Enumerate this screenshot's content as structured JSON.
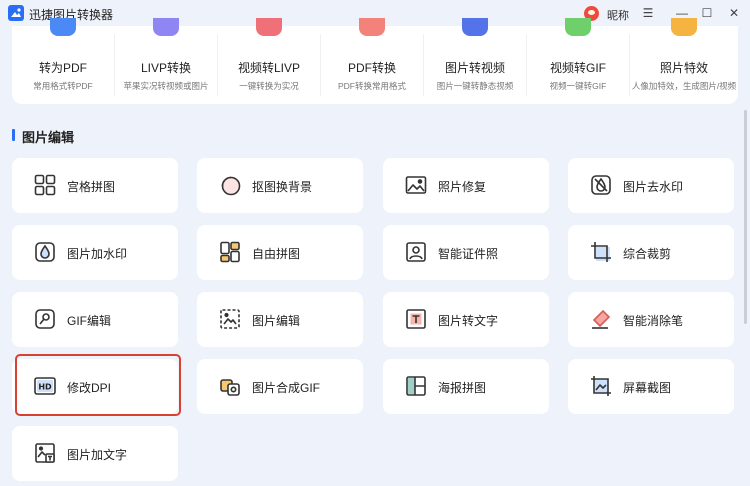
{
  "app": {
    "title": "迅捷图片转换器",
    "nickname": "昵称",
    "accent_color": "#2b6ef6",
    "window_controls": [
      "☺",
      "☰",
      "—",
      "☐",
      "✕"
    ]
  },
  "top_features": [
    {
      "name": "转为PDF",
      "desc": "常用格式转PDF",
      "color": "#4b8af5"
    },
    {
      "name": "LIVP转换",
      "desc": "苹果实况转视频或图片",
      "color": "#8f86f3"
    },
    {
      "name": "视频转LIVP",
      "desc": "一键转换为实况",
      "color": "#f0707a"
    },
    {
      "name": "PDF转换",
      "desc": "PDF转换常用格式",
      "color": "#f2827a"
    },
    {
      "name": "图片转视频",
      "desc": "图片一键转静态视频",
      "color": "#5573e8"
    },
    {
      "name": "视频转GIF",
      "desc": "视频一键转GIF",
      "color": "#6fcf6a"
    },
    {
      "name": "照片特效",
      "desc": "人像加特效，生成图片/视频",
      "color": "#f5b342"
    }
  ],
  "section": {
    "title": "图片编辑"
  },
  "tools": [
    {
      "label": "宫格拼图",
      "icon": "grid-icon"
    },
    {
      "label": "抠图换背景",
      "icon": "cutout-icon"
    },
    {
      "label": "照片修复",
      "icon": "photo-repair-icon"
    },
    {
      "label": "图片去水印",
      "icon": "remove-watermark-icon"
    },
    {
      "label": "图片加水印",
      "icon": "add-watermark-icon"
    },
    {
      "label": "自由拼图",
      "icon": "free-collage-icon"
    },
    {
      "label": "智能证件照",
      "icon": "id-photo-icon"
    },
    {
      "label": "综合裁剪",
      "icon": "crop-icon"
    },
    {
      "label": "GIF编辑",
      "icon": "gif-edit-icon"
    },
    {
      "label": "图片编辑",
      "icon": "image-edit-icon"
    },
    {
      "label": "图片转文字",
      "icon": "image-to-text-icon"
    },
    {
      "label": "智能消除笔",
      "icon": "eraser-icon"
    },
    {
      "label": "修改DPI",
      "icon": "hd-dpi-icon"
    },
    {
      "label": "图片合成GIF",
      "icon": "compose-gif-icon"
    },
    {
      "label": "海报拼图",
      "icon": "poster-collage-icon"
    },
    {
      "label": "屏幕截图",
      "icon": "screenshot-icon"
    },
    {
      "label": "图片加文字",
      "icon": "add-text-icon"
    }
  ]
}
